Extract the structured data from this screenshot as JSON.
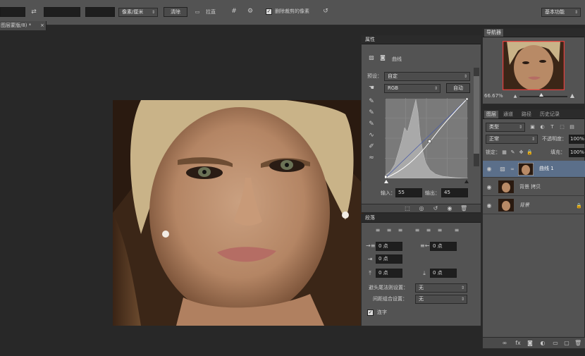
{
  "options_bar": {
    "units_select": "像素/厘米",
    "clear_button": "清除",
    "straighten_button": "拉直",
    "delete_cropped_label": "删除裁剪的像素",
    "workspace_select": "基本功能"
  },
  "document": {
    "tab_title": "图层蒙版/8) *",
    "close": "×"
  },
  "properties_panel": {
    "tab": "属性",
    "title": "曲线",
    "preset_label": "预设：",
    "preset_value": "自定",
    "channel_value": "RGB",
    "auto_button": "自动",
    "input_label": "输入：",
    "input_value": "55",
    "output_label": "输出：",
    "output_value": "45"
  },
  "paragraph_panel": {
    "tab": "段落",
    "indent_left": "0 点",
    "indent_right": "0 点",
    "first_line": "0 点",
    "space_before": "0 点",
    "space_after": "0 点",
    "hyphen_label": "避头尾法则设置：",
    "hyphen_value": "无",
    "compose_label": "间距组合设置：",
    "compose_value": "无",
    "hyphenate_label": "连字"
  },
  "navigator_panel": {
    "tab": "导航器",
    "zoom": "66.67%"
  },
  "layers_panel": {
    "tabs": [
      "图层",
      "通道",
      "路径",
      "历史记录"
    ],
    "kind_select": "类型",
    "blend_mode": "正常",
    "opacity_label": "不透明度：",
    "opacity_value": "100%",
    "lock_label": "锁定：",
    "fill_label": "填充：",
    "fill_value": "100%",
    "layers": [
      {
        "name": "曲线 1"
      },
      {
        "name": "背景 拷贝"
      },
      {
        "name": "背景"
      }
    ]
  },
  "colors": {
    "ui_bg": "#282828",
    "panel_bg": "#535353",
    "selected_layer": "#5b6f8a"
  }
}
